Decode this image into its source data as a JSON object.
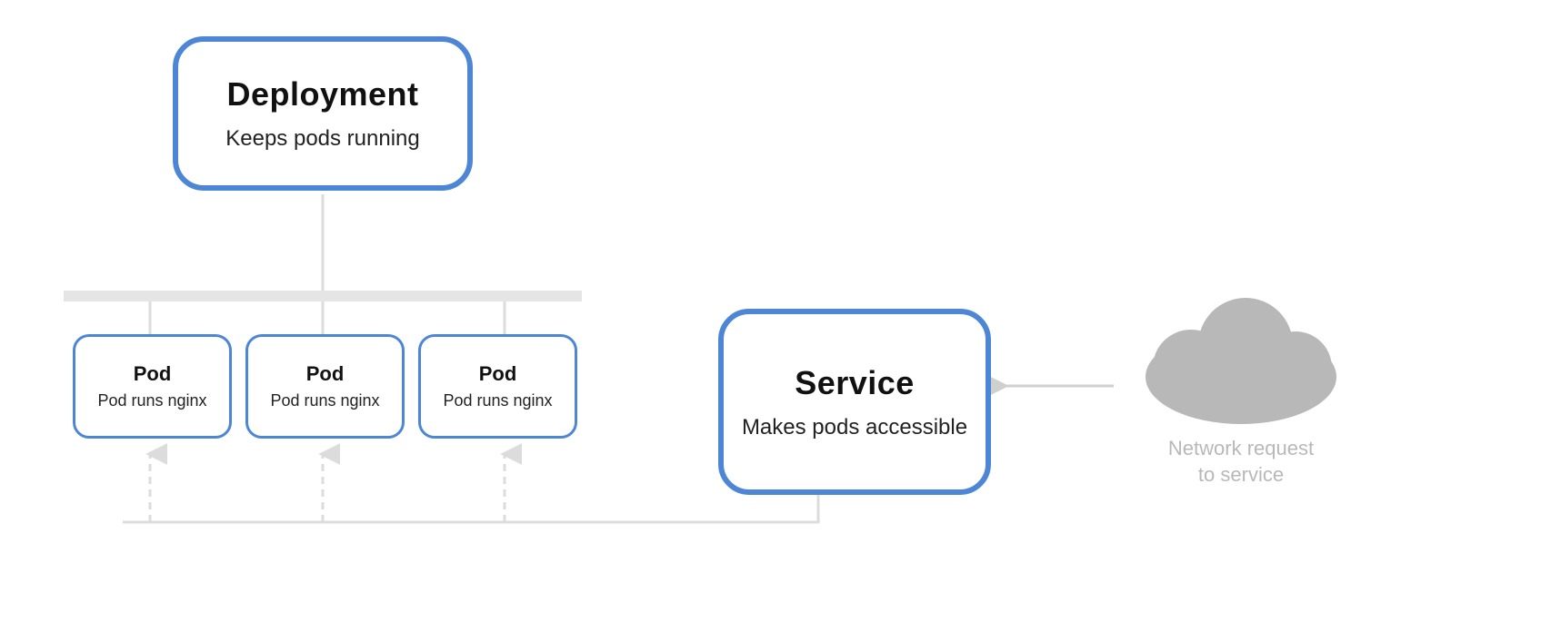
{
  "deployment": {
    "title": "Deployment",
    "subtitle": "Keeps pods running"
  },
  "pods": [
    {
      "title": "Pod",
      "subtitle": "Pod runs nginx"
    },
    {
      "title": "Pod",
      "subtitle": "Pod runs nginx"
    },
    {
      "title": "Pod",
      "subtitle": "Pod runs nginx"
    }
  ],
  "service": {
    "title": "Service",
    "subtitle": "Makes pods accessible"
  },
  "cloud": {
    "label_line1": "Network request",
    "label_line2": "to service"
  },
  "colors": {
    "accent": "#4e86d6",
    "line": "#dcdcdc",
    "line_dark": "#cfcfcf",
    "cloud": "#b8b8b8"
  }
}
